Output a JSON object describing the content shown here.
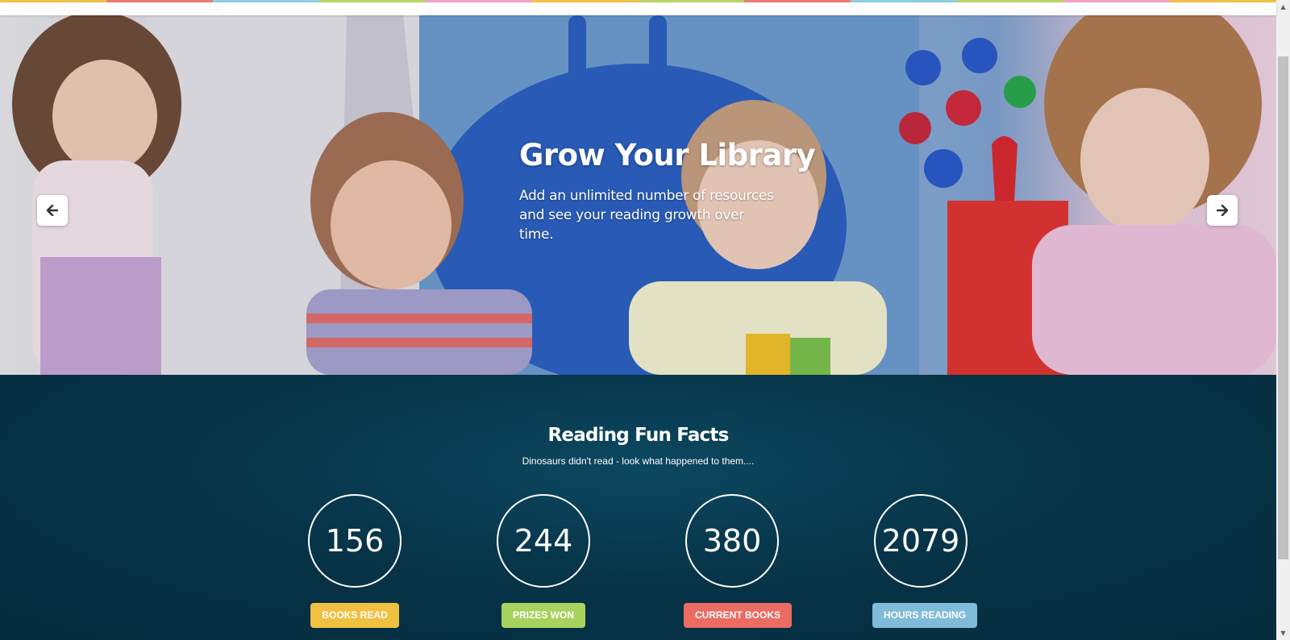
{
  "hero": {
    "title": "Grow Your Library",
    "subtitle_line1": "Add an unlimited number of resources",
    "subtitle_line2": "and see your reading growth over time.",
    "prev_icon": "arrow-left-icon",
    "next_icon": "arrow-right-icon"
  },
  "facts": {
    "title": "Reading Fun Facts",
    "subtitle": "Dinosaurs didn't read - look what happened to them....",
    "stats": [
      {
        "value": "156",
        "label": "BOOKS READ",
        "color": "#f0c040"
      },
      {
        "value": "244",
        "label": "PRIZES WON",
        "color": "#a7d25e"
      },
      {
        "value": "380",
        "label": "CURRENT BOOKS",
        "color": "#ec6b63"
      },
      {
        "value": "2079",
        "label": "HOURS READING",
        "color": "#7fbcd9"
      }
    ]
  },
  "colors": {
    "facts_background": "#073448",
    "rainbow": [
      "#f3c44a",
      "#ef7c74",
      "#8fd0e3",
      "#b8d765",
      "#f6a3c8",
      "#f3c44a",
      "#b8d765",
      "#ef7c74",
      "#8fd0e3",
      "#b8d765",
      "#f6a3c8",
      "#f3c44a"
    ]
  }
}
